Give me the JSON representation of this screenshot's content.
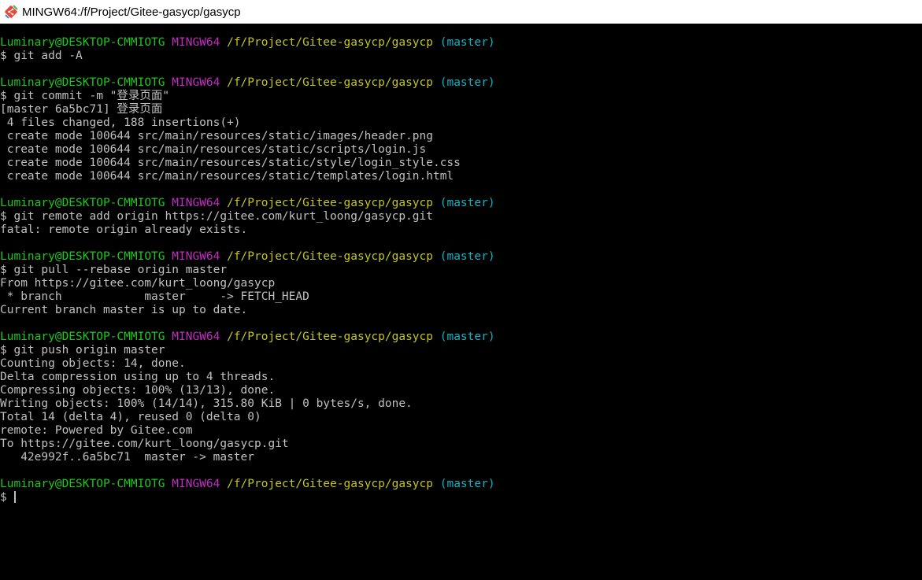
{
  "window": {
    "title": "MINGW64:/f/Project/Gitee-gasycp/gasycp",
    "icon": "git-bash-icon"
  },
  "colors": {
    "user_host": "#1cc71c",
    "shell": "#c12dc1",
    "path": "#c5c51a",
    "branch": "#13b3c4",
    "text": "#c0c0c0",
    "background": "#000000"
  },
  "prompt": {
    "user_host": "Luminary@DESKTOP-CMMIOTG",
    "shell": "MINGW64",
    "path": "/f/Project/Gitee-gasycp/gasycp",
    "branch": "(master)"
  },
  "blocks": [
    {
      "command": "$ git add -A",
      "output": []
    },
    {
      "command": "$ git commit -m \"登录页面\"",
      "output": [
        "[master 6a5bc71] 登录页面",
        " 4 files changed, 188 insertions(+)",
        " create mode 100644 src/main/resources/static/images/header.png",
        " create mode 100644 src/main/resources/static/scripts/login.js",
        " create mode 100644 src/main/resources/static/style/login_style.css",
        " create mode 100644 src/main/resources/static/templates/login.html"
      ]
    },
    {
      "command": "$ git remote add origin https://gitee.com/kurt_loong/gasycp.git",
      "output": [
        "fatal: remote origin already exists."
      ]
    },
    {
      "command": "$ git pull --rebase origin master",
      "output": [
        "From https://gitee.com/kurt_loong/gasycp",
        " * branch            master     -> FETCH_HEAD",
        "Current branch master is up to date."
      ]
    },
    {
      "command": "$ git push origin master",
      "output": [
        "Counting objects: 14, done.",
        "Delta compression using up to 4 threads.",
        "Compressing objects: 100% (13/13), done.",
        "Writing objects: 100% (14/14), 315.80 KiB | 0 bytes/s, done.",
        "Total 14 (delta 4), reused 0 (delta 0)",
        "remote: Powered by Gitee.com",
        "To https://gitee.com/kurt_loong/gasycp.git",
        "   42e992f..6a5bc71  master -> master"
      ]
    },
    {
      "command": "$ ",
      "output": [],
      "active": true
    }
  ]
}
